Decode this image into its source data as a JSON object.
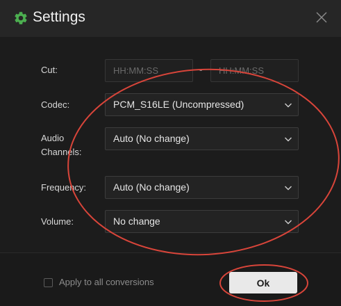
{
  "window": {
    "title": "Settings",
    "accent_color": "#4caf50"
  },
  "form": {
    "cut": {
      "label": "Cut:",
      "start_placeholder": "HH:MM:SS",
      "separator": "-",
      "end_placeholder": "HH:MM:SS"
    },
    "codec": {
      "label": "Codec:",
      "value": "PCM_S16LE (Uncompressed)"
    },
    "audio_channels": {
      "label_line1": "Audio",
      "label_line2": "Channels:",
      "value": "Auto (No change)"
    },
    "frequency": {
      "label": "Frequency:",
      "value": "Auto (No change)"
    },
    "volume": {
      "label": "Volume:",
      "value": "No change"
    }
  },
  "footer": {
    "apply_all_label": "Apply to all conversions",
    "apply_all_checked": false,
    "ok_label": "Ok"
  },
  "annotation_color": "#d9453a"
}
